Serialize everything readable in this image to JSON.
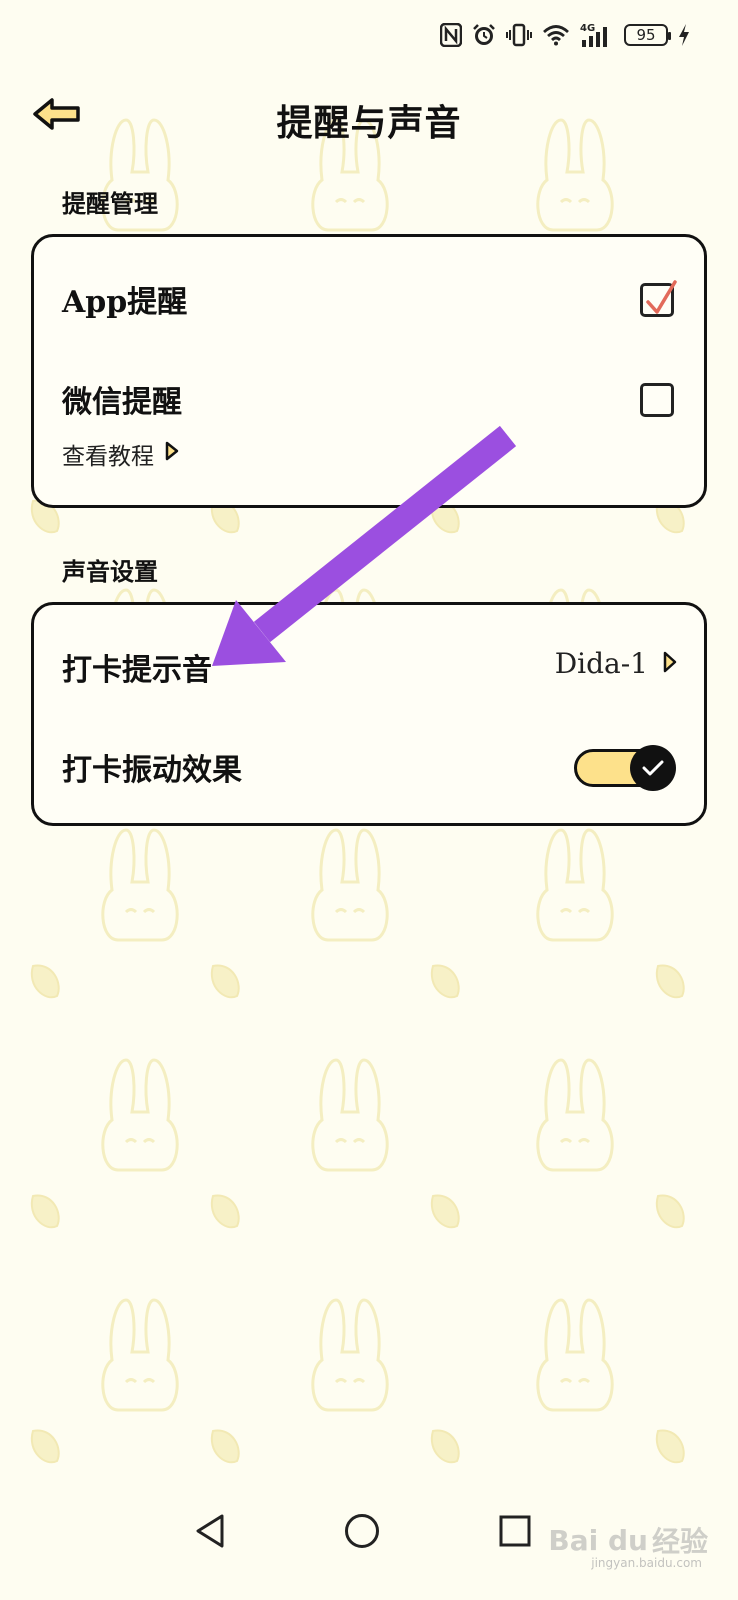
{
  "status_bar": {
    "network": "4G",
    "battery": "95"
  },
  "header": {
    "title": "提醒与声音"
  },
  "sections": {
    "reminder": {
      "title": "提醒管理",
      "app_reminder_label": "App提醒",
      "wechat_reminder_label": "微信提醒",
      "tutorial_link": "查看教程"
    },
    "sound": {
      "title": "声音设置",
      "checkin_sound_label": "打卡提示音",
      "checkin_sound_value": "Dida-1",
      "vibration_label": "打卡振动效果"
    }
  },
  "watermark": {
    "brand": "Bai du",
    "brand_cn": "经验",
    "sub": "jingyan.baidu.com"
  },
  "colors": {
    "background": "#fefdf1",
    "toggle_track": "#fde18b",
    "check_mark": "#e26a5a",
    "annotation_arrow": "#9b4fe0",
    "back_arrow_fill": "#fde18b"
  },
  "icons": {
    "back": "back-arrow-icon",
    "nfc": "nfc-icon",
    "alarm": "alarm-icon",
    "vibrate": "vibrate-icon",
    "wifi": "wifi-icon",
    "signal": "signal-icon",
    "charging": "charging-icon",
    "chevron": "chevron-right-icon",
    "check": "check-icon",
    "nav_back": "nav-back-icon",
    "nav_home": "nav-home-icon",
    "nav_recent": "nav-recent-icon"
  },
  "state": {
    "app_reminder_checked": true,
    "wechat_reminder_checked": false,
    "vibration_enabled": true
  }
}
